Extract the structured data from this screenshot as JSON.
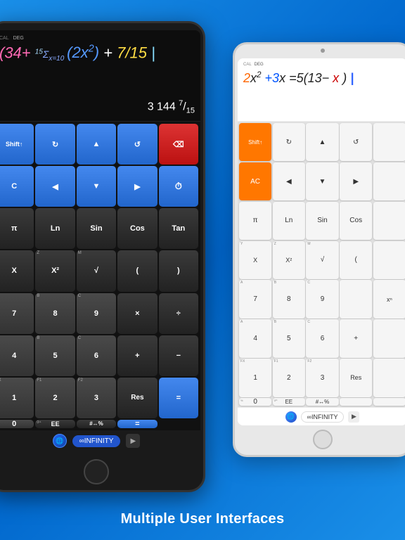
{
  "subtitle": "Multiple User Interfaces",
  "darkTablet": {
    "calLabel": "CAL",
    "degLabel": "DEG",
    "expression": "34+ Σ(2x²)+7/15",
    "result": "3 144 7/15",
    "buttons": [
      {
        "label": "Shift↑",
        "type": "blue",
        "subLabel": ""
      },
      {
        "label": "↻",
        "type": "blue",
        "subLabel": ""
      },
      {
        "label": "▲",
        "type": "blue",
        "subLabel": ""
      },
      {
        "label": "↺",
        "type": "blue",
        "subLabel": ""
      },
      {
        "label": "⌫",
        "type": "red",
        "subLabel": ""
      },
      {
        "label": "C",
        "type": "blue",
        "subLabel": ""
      },
      {
        "label": "◀",
        "type": "blue",
        "subLabel": ""
      },
      {
        "label": "▼",
        "type": "blue",
        "subLabel": ""
      },
      {
        "label": "▶",
        "type": "blue",
        "subLabel": ""
      },
      {
        "label": "🕐",
        "type": "blue",
        "subLabel": ""
      },
      {
        "label": "π",
        "type": "dark",
        "subLabel": ""
      },
      {
        "label": "Ln",
        "type": "dark",
        "subLabel": ""
      },
      {
        "label": "Sin",
        "type": "dark",
        "subLabel": ""
      },
      {
        "label": "Cos",
        "type": "dark",
        "subLabel": ""
      },
      {
        "label": "Tan",
        "type": "dark",
        "subLabel": ""
      },
      {
        "label": "X",
        "type": "dark",
        "subLabel": "Y"
      },
      {
        "label": "X²",
        "type": "dark",
        "subLabel": "Z"
      },
      {
        "label": "√",
        "type": "dark",
        "subLabel": "M"
      },
      {
        "label": "(",
        "type": "dark",
        "subLabel": ""
      },
      {
        "label": ")",
        "type": "dark",
        "subLabel": ""
      },
      {
        "label": "7",
        "type": "med",
        "subLabel": "A"
      },
      {
        "label": "8",
        "type": "med",
        "subLabel": "B"
      },
      {
        "label": "9",
        "type": "med",
        "subLabel": "C"
      },
      {
        "label": "×",
        "type": "dark",
        "subLabel": ""
      },
      {
        "label": "÷",
        "type": "dark",
        "subLabel": ""
      },
      {
        "label": "4",
        "type": "med",
        "subLabel": "A"
      },
      {
        "label": "5",
        "type": "med",
        "subLabel": "B"
      },
      {
        "label": "6",
        "type": "med",
        "subLabel": "C"
      },
      {
        "label": "+",
        "type": "dark",
        "subLabel": ""
      },
      {
        "label": "−",
        "type": "dark",
        "subLabel": ""
      },
      {
        "label": "1",
        "type": "med",
        "subLabel": "FX"
      },
      {
        "label": "2",
        "type": "med",
        "subLabel": "F1"
      },
      {
        "label": "3",
        "type": "med",
        "subLabel": "F2"
      },
      {
        "label": "Res",
        "type": "dark",
        "subLabel": ""
      },
      {
        "label": "=",
        "type": "blue",
        "subLabel": ""
      },
      {
        "label": "0",
        "type": "med",
        "subLabel": "0¹¹"
      },
      {
        "label": "EE",
        "type": "dark",
        "subLabel": "0¹¹"
      },
      {
        "label": "#↔%",
        "type": "dark",
        "subLabel": ""
      },
      {
        "label": "=",
        "type": "blue",
        "subLabel": ""
      }
    ],
    "infinityLabel": "∞INFINITY",
    "arrowLabel": ">"
  },
  "lightTablet": {
    "calLabel": "CAL",
    "degLabel": "DEG",
    "expression": "2x²+3x=5(13−x)",
    "buttons": [
      {
        "label": "Shift↑",
        "type": "orange"
      },
      {
        "label": "↻",
        "type": "light"
      },
      {
        "label": "▲",
        "type": "light"
      },
      {
        "label": "↺",
        "type": "light"
      },
      {
        "label": "",
        "type": "light"
      },
      {
        "label": "AC",
        "type": "orange"
      },
      {
        "label": "◀",
        "type": "light"
      },
      {
        "label": "▼",
        "type": "light"
      },
      {
        "label": "▶",
        "type": "light"
      },
      {
        "label": "",
        "type": "light"
      },
      {
        "label": "π",
        "type": "light"
      },
      {
        "label": "Ln",
        "type": "light"
      },
      {
        "label": "Sin",
        "type": "light"
      },
      {
        "label": "Cos",
        "type": "light"
      },
      {
        "label": "",
        "type": "light"
      },
      {
        "label": "X",
        "type": "light"
      },
      {
        "label": "X²",
        "type": "light"
      },
      {
        "label": "√",
        "type": "light"
      },
      {
        "label": "(",
        "type": "light"
      },
      {
        "label": "",
        "type": "light"
      },
      {
        "label": "7",
        "type": "light"
      },
      {
        "label": "8",
        "type": "light"
      },
      {
        "label": "9",
        "type": "light"
      },
      {
        "label": "",
        "type": "light"
      },
      {
        "label": "xⁿ",
        "type": "light"
      },
      {
        "label": "4",
        "type": "light"
      },
      {
        "label": "5",
        "type": "light"
      },
      {
        "label": "6",
        "type": "light"
      },
      {
        "label": "+",
        "type": "light"
      },
      {
        "label": "",
        "type": "light"
      },
      {
        "label": "1",
        "type": "light"
      },
      {
        "label": "2",
        "type": "light"
      },
      {
        "label": "3",
        "type": "light"
      },
      {
        "label": "Res",
        "type": "light"
      },
      {
        "label": "",
        "type": "light"
      },
      {
        "label": "0",
        "type": "light"
      },
      {
        "label": "EE",
        "type": "light"
      },
      {
        "label": "#↔%",
        "type": "light"
      },
      {
        "label": "",
        "type": "light"
      },
      {
        "label": "",
        "type": "light"
      }
    ],
    "infinityLabel": "∞INFINITY",
    "arrowLabel": ">"
  }
}
